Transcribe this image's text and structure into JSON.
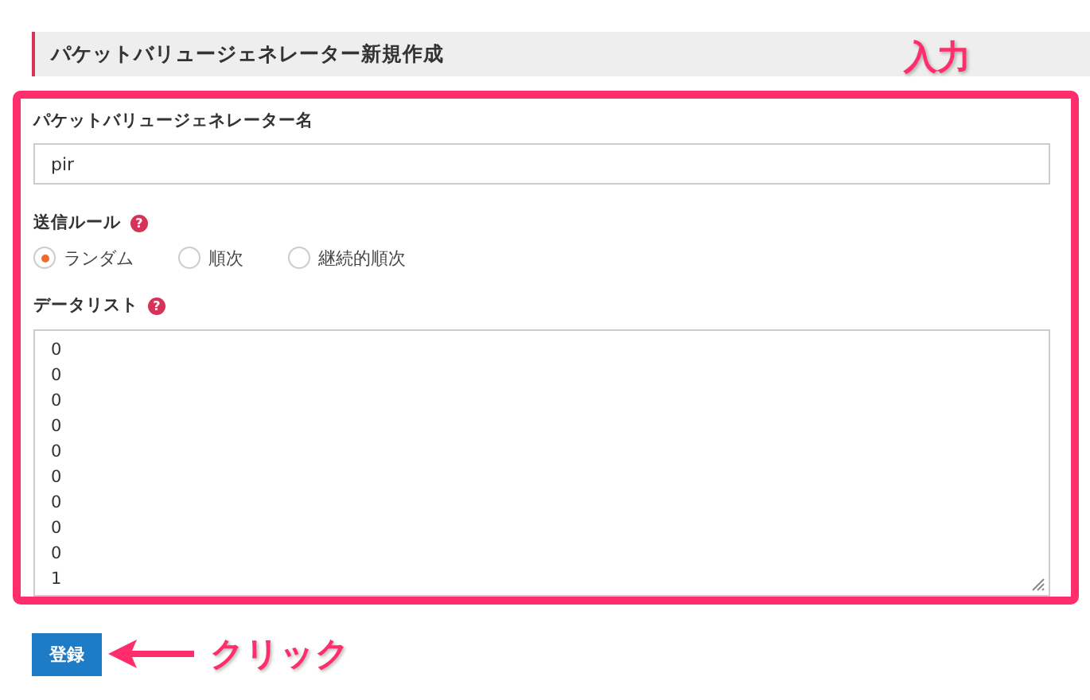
{
  "heading": "パケットバリュージェネレーター新規作成",
  "annotations": {
    "input_label": "入力",
    "click_label": "クリック"
  },
  "form": {
    "name_label": "パケットバリュージェネレーター名",
    "name_value": "pir",
    "rule_label": "送信ルール",
    "rule_help": "?",
    "rules": [
      {
        "label": "ランダム",
        "selected": true
      },
      {
        "label": "順次",
        "selected": false
      },
      {
        "label": "継続的順次",
        "selected": false
      }
    ],
    "list_label": "データリスト",
    "list_help": "?",
    "list_lines": [
      "0",
      "0",
      "0",
      "0",
      "0",
      "0",
      "0",
      "0",
      "0",
      "1"
    ]
  },
  "submit": "登録"
}
